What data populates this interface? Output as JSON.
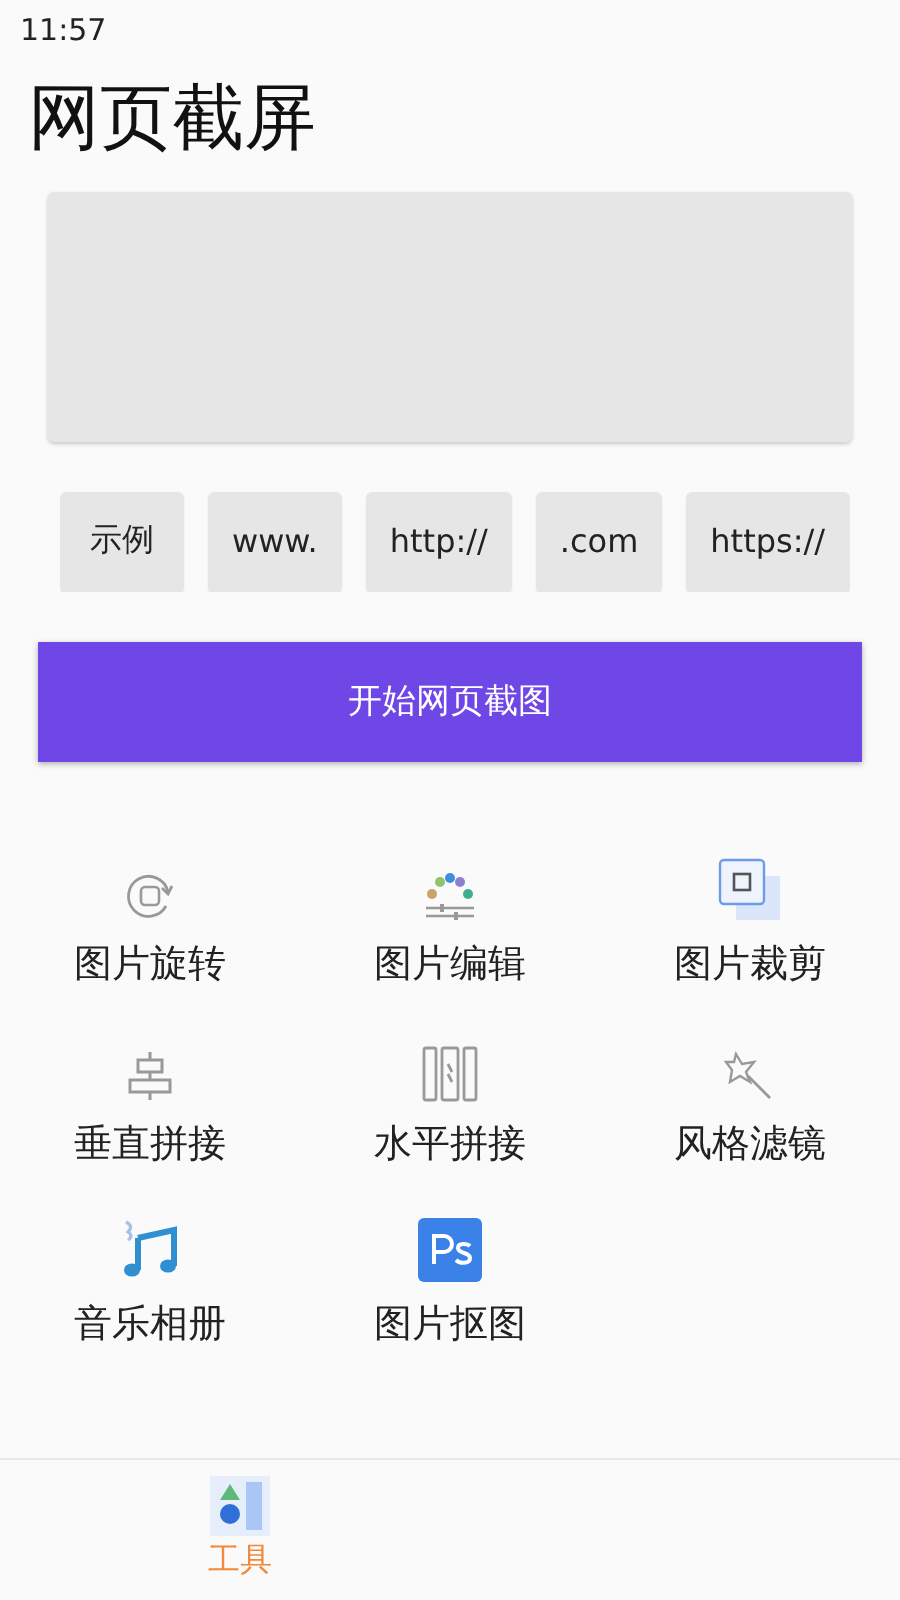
{
  "status_bar": {
    "time": "11:57"
  },
  "title": "网页截屏",
  "url_input": {
    "kind": "textarea"
  },
  "chips": [
    "示例",
    "www.",
    "http://",
    ".com",
    "https://"
  ],
  "start_button": "开始网页截图",
  "tools": [
    {
      "label": "图片旋转",
      "kind": "rotate"
    },
    {
      "label": "图片编辑",
      "kind": "edit"
    },
    {
      "label": "图片裁剪",
      "kind": "crop"
    },
    {
      "label": "垂直拼接",
      "kind": "vertical"
    },
    {
      "label": "水平拼接",
      "kind": "horizontal"
    },
    {
      "label": "风格滤镜",
      "kind": "filter"
    },
    {
      "label": "音乐相册",
      "kind": "music"
    },
    {
      "label": "图片抠图",
      "kind": "ps"
    }
  ],
  "bottom_nav": [
    {
      "label": "工具",
      "selected": true
    }
  ]
}
